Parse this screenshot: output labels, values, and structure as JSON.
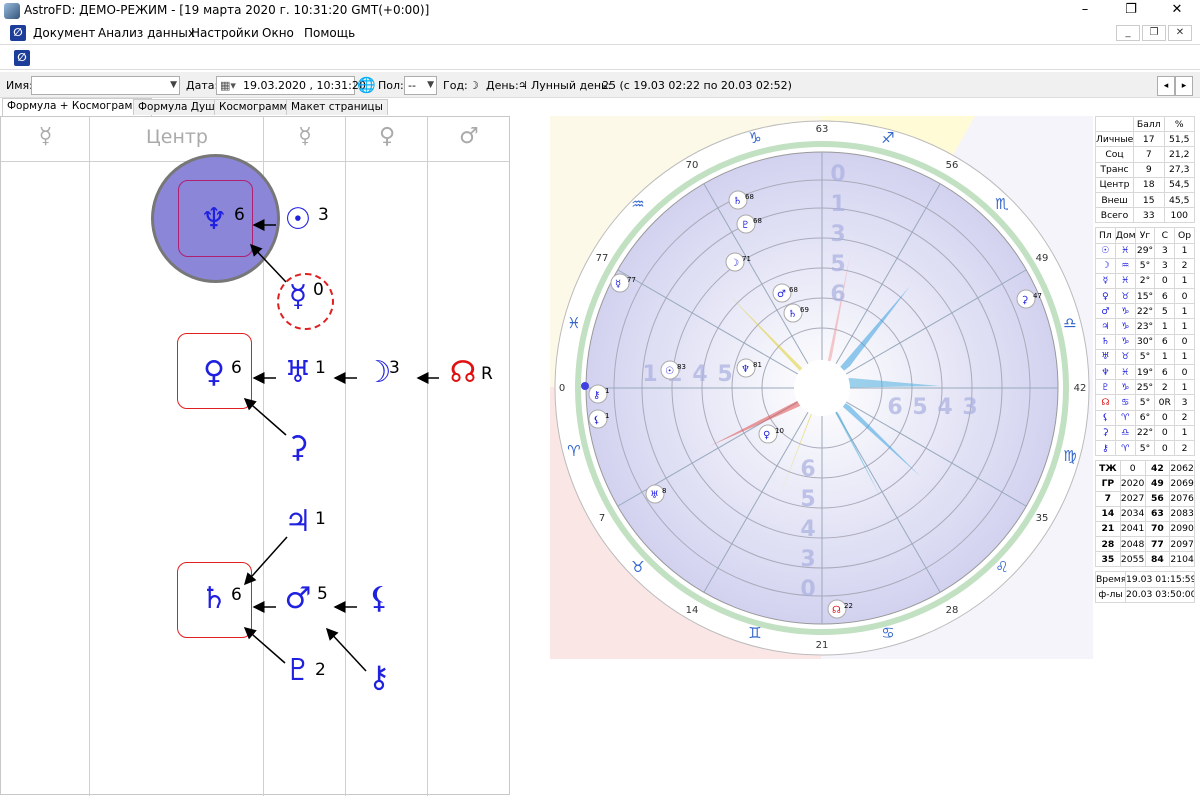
{
  "window": {
    "title": "AstroFD: ДЕМО-РЕЖИМ - [19 марта 2020 г. 10:31:20 GMT(+0:00)]",
    "controls": [
      "–",
      "❐",
      "✕"
    ]
  },
  "menu": [
    "Документ",
    "Анализ данных",
    "Настройки",
    "Окно",
    "Помощь"
  ],
  "mdi_controls": [
    "_",
    "❐",
    "✕"
  ],
  "app_logo": "∅",
  "toolbar": {
    "name_label": "Имя:",
    "name_value": "",
    "date_label": "Дата:",
    "date_value": "19.03.2020 , 10:31:20",
    "gender_label": "Пол:",
    "gender_value": "--",
    "year_label": "Год:",
    "year_value": "☽",
    "day_label": "День:",
    "day_value": "♃",
    "lunar_label": "Лунный день:",
    "lunar_value": "25 (с 19.03 02:22 по 20.03 02:52)",
    "nav_prev": "◂",
    "nav_next": "▸"
  },
  "tabs": [
    "Формула + Космограмма",
    "Формула Души",
    "Космограмма",
    "Макет страницы"
  ],
  "formula": {
    "headers": [
      "☿",
      "Центр",
      "☿",
      "♀",
      "♂"
    ],
    "cells": [
      {
        "g": "♆",
        "n": "6"
      },
      {
        "g": "☉",
        "n": "3"
      },
      {
        "g": "☿",
        "n": "0"
      },
      {
        "g": "♀",
        "n": "6"
      },
      {
        "g": "♅",
        "n": "1"
      },
      {
        "g": "☽",
        "n": "3"
      },
      {
        "g": "☊",
        "n": "R"
      },
      {
        "g": "⚳",
        "n": ""
      },
      {
        "g": "♃",
        "n": "1"
      },
      {
        "g": "♄",
        "n": "6"
      },
      {
        "g": "♂",
        "n": "5"
      },
      {
        "g": "⚸",
        "n": ""
      },
      {
        "g": "♇",
        "n": "2"
      },
      {
        "g": "⚷",
        "n": ""
      }
    ]
  },
  "chart_data": {
    "type": "table",
    "wheel": {
      "signs": [
        "♈",
        "♉",
        "♊",
        "♋",
        "♌",
        "♍",
        "♎",
        "♏",
        "♐",
        "♑",
        "♒",
        "♓"
      ],
      "outer_numbers": [
        "0",
        "7",
        "14",
        "21",
        "28",
        "35",
        "42",
        "49",
        "56",
        "63",
        "70",
        "77"
      ],
      "planets": [
        {
          "g": "♄",
          "n": "68"
        },
        {
          "g": "♇",
          "n": "68"
        },
        {
          "g": "☽",
          "n": "71"
        },
        {
          "g": "♂",
          "n": "68"
        },
        {
          "g": "♄",
          "n": "69"
        },
        {
          "g": "☿",
          "n": "77"
        },
        {
          "g": "☉",
          "n": "83"
        },
        {
          "g": "♆",
          "n": "81"
        },
        {
          "g": "⚷",
          "n": "1"
        },
        {
          "g": "⚸",
          "n": "1"
        },
        {
          "g": "♀",
          "n": "10"
        },
        {
          "g": "♅",
          "n": "8"
        },
        {
          "g": "☊",
          "n": "22"
        },
        {
          "g": "⚳",
          "n": "47"
        }
      ]
    },
    "summary": {
      "header": [
        "",
        "Балл",
        "%"
      ],
      "rows": [
        [
          "Личные",
          "17",
          "51,5"
        ],
        [
          "Соц",
          "7",
          "21,2"
        ],
        [
          "Транс",
          "9",
          "27,3"
        ],
        [
          "Центр",
          "18",
          "54,5"
        ],
        [
          "Внеш",
          "15",
          "45,5"
        ],
        [
          "Всего",
          "33",
          "100"
        ]
      ]
    },
    "planets_table": {
      "header": [
        "Пл",
        "Дом",
        "Уг",
        "С",
        "Ор"
      ],
      "rows": [
        [
          "☉",
          "♓",
          "29°",
          "3",
          "1"
        ],
        [
          "☽",
          "♒",
          "5°",
          "3",
          "2"
        ],
        [
          "☿",
          "♓",
          "2°",
          "0",
          "1"
        ],
        [
          "♀",
          "♉",
          "15°",
          "6",
          "0"
        ],
        [
          "♂",
          "♑",
          "22°",
          "5",
          "1"
        ],
        [
          "♃",
          "♑",
          "23°",
          "1",
          "1"
        ],
        [
          "♄",
          "♑",
          "30°",
          "6",
          "0"
        ],
        [
          "♅",
          "♉",
          "5°",
          "1",
          "1"
        ],
        [
          "♆",
          "♓",
          "19°",
          "6",
          "0"
        ],
        [
          "♇",
          "♑",
          "25°",
          "2",
          "1"
        ],
        [
          "☊",
          "♋",
          "5°",
          "0R",
          "3"
        ],
        [
          "⚸",
          "♈",
          "6°",
          "0",
          "2"
        ],
        [
          "⚳",
          "♎",
          "22°",
          "0",
          "1"
        ],
        [
          "⚷",
          "♈",
          "5°",
          "0",
          "2"
        ]
      ]
    },
    "cycles_table": {
      "rows": [
        [
          "ТЖ",
          "0",
          "42",
          "2062"
        ],
        [
          "ГР",
          "2020",
          "49",
          "2069"
        ],
        [
          "7",
          "2027",
          "56",
          "2076"
        ],
        [
          "14",
          "2034",
          "63",
          "2083"
        ],
        [
          "21",
          "2041",
          "70",
          "2090"
        ],
        [
          "28",
          "2048",
          "77",
          "2097"
        ],
        [
          "35",
          "2055",
          "84",
          "2104"
        ]
      ]
    },
    "time_table": {
      "rows": [
        [
          "Время",
          "19.03 01:15:59"
        ],
        [
          "ф-лы",
          "20.03 03:50:00"
        ]
      ]
    }
  }
}
